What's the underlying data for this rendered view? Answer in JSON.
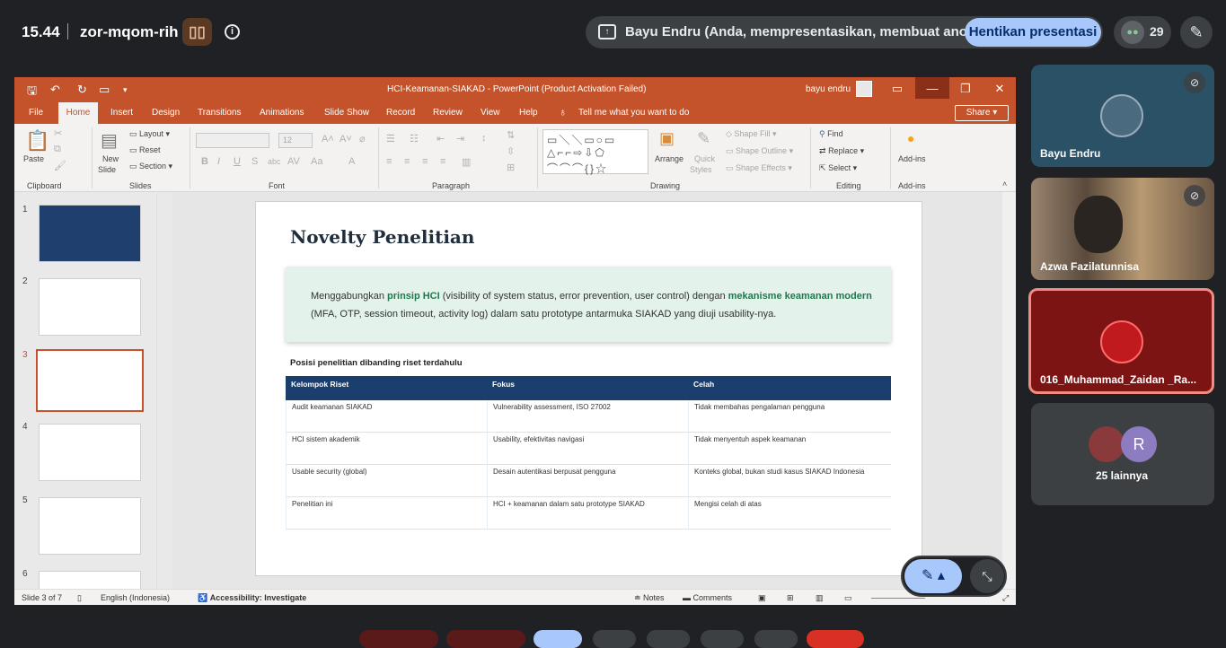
{
  "meet": {
    "clock": "15.44",
    "meeting_code": "zor-mqom-rih",
    "presenter_banner": "Bayu Endru (Anda, mempresentasikan, membuat anotasi)",
    "stop_button": "Hentikan presentasi",
    "participants_count": "29"
  },
  "ppt": {
    "title": "HCI-Keamanan-SIAKAD  -  PowerPoint (Product Activation Failed)",
    "user": "bayu endru",
    "tabs": [
      "File",
      "Home",
      "Insert",
      "Design",
      "Transitions",
      "Animations",
      "Slide Show",
      "Record",
      "Review",
      "View",
      "Help"
    ],
    "tell_me": "Tell me what you want to do",
    "share": "Share",
    "ribbon": {
      "paste": "Paste",
      "clipboard": "Clipboard",
      "new_slide": "New",
      "new_slide2": "Slide",
      "layout": "Layout",
      "reset": "Reset",
      "section": "Section",
      "slides": "Slides",
      "font_size": "12",
      "font": "Font",
      "paragraph": "Paragraph",
      "arrange": "Arrange",
      "quick_styles": "Quick",
      "quick_styles2": "Styles",
      "shape_fill": "Shape Fill",
      "shape_outline": "Shape Outline",
      "shape_effects": "Shape Effects",
      "drawing": "Drawing",
      "find": "Find",
      "replace": "Replace",
      "select": "Select",
      "editing": "Editing",
      "addins": "Add-ins",
      "addins_group": "Add-ins"
    },
    "thumbs": [
      "1",
      "2",
      "3",
      "4",
      "5",
      "6"
    ],
    "slide": {
      "title": "Novelty Penelitian",
      "callout_pre": "Menggabungkan ",
      "callout_b1": "prinsip HCI",
      "callout_mid": " (visibility of system status, error prevention, user control) dengan ",
      "callout_b2": "mekanisme keamanan modern",
      "callout_post": " (MFA, OTP, session timeout, activity log) dalam satu prototype antarmuka SIAKAD yang diuji usability-nya.",
      "table_caption": "Posisi penelitian dibanding riset terdahulu",
      "headers": [
        "Kelompok Riset",
        "Fokus",
        "Celah"
      ],
      "rows": [
        [
          "Audit keamanan SIAKAD",
          "Vulnerability assessment, ISO 27002",
          "Tidak membahas pengalaman pengguna"
        ],
        [
          "HCI sistem akademik",
          "Usability, efektivitas navigasi",
          "Tidak menyentuh aspek keamanan"
        ],
        [
          "Usable security (global)",
          "Desain autentikasi berpusat pengguna",
          "Konteks global, bukan studi kasus SIAKAD Indonesia"
        ],
        [
          "Penelitian ini",
          "HCI + keamanan dalam satu prototype SIAKAD",
          "Mengisi celah di atas"
        ]
      ]
    },
    "status": {
      "slide_of": "Slide 3 of 7",
      "language": "English (Indonesia)",
      "accessibility": "Accessibility: Investigate",
      "notes": "Notes",
      "comments": "Comments"
    }
  },
  "participants": [
    {
      "name": "Bayu Endru",
      "avatar_color": "#4a6a80"
    },
    {
      "name": "Azwa Fazilatunnisa",
      "avatar_color": "#8a7560"
    },
    {
      "name": "016_Muhammad_Zaidan _Ra...",
      "avatar_color": "#c0191e"
    },
    {
      "name": "25 lainnya",
      "avatar_letter": "R",
      "avatar_color": "#8e7cc3"
    }
  ],
  "colors": {
    "ppt_accent": "#c4532b",
    "meet_bg": "#202124",
    "stop_button": "#a8c7fa",
    "table_header": "#1a3f6e",
    "callout_bg": "#e3f2ea"
  }
}
